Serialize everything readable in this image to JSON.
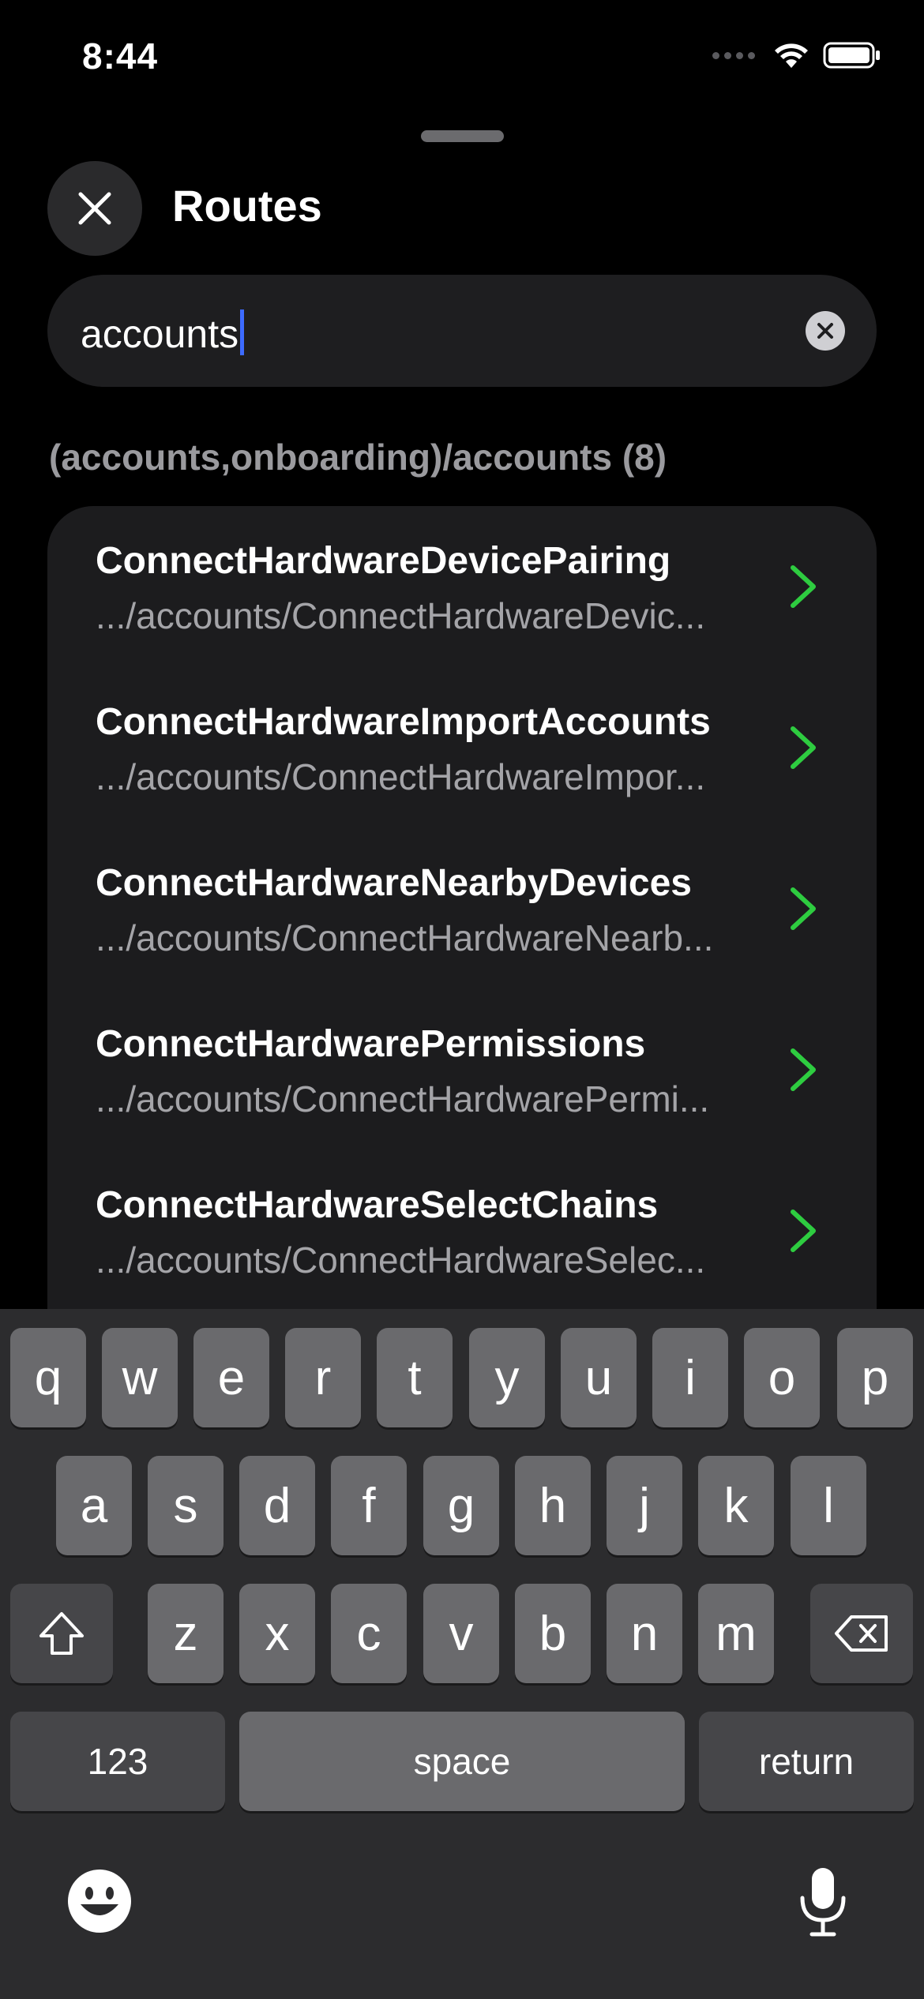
{
  "status_bar": {
    "time": "8:44"
  },
  "header": {
    "title": "Routes"
  },
  "search": {
    "value": "accounts"
  },
  "section": {
    "title": "(accounts,onboarding)/accounts (8)"
  },
  "routes": [
    {
      "name": "ConnectHardwareDevicePairing",
      "path": ".../accounts/ConnectHardwareDevic..."
    },
    {
      "name": "ConnectHardwareImportAccounts",
      "path": ".../accounts/ConnectHardwareImpor..."
    },
    {
      "name": "ConnectHardwareNearbyDevices",
      "path": ".../accounts/ConnectHardwareNearb..."
    },
    {
      "name": "ConnectHardwarePermissions",
      "path": ".../accounts/ConnectHardwarePermi..."
    },
    {
      "name": "ConnectHardwareSelectChains",
      "path": ".../accounts/ConnectHardwareSelec..."
    }
  ],
  "keyboard": {
    "row1": [
      "q",
      "w",
      "e",
      "r",
      "t",
      "y",
      "u",
      "i",
      "o",
      "p"
    ],
    "row2": [
      "a",
      "s",
      "d",
      "f",
      "g",
      "h",
      "j",
      "k",
      "l"
    ],
    "row3": [
      "z",
      "x",
      "c",
      "v",
      "b",
      "n",
      "m"
    ],
    "numbers_label": "123",
    "space_label": "space",
    "return_label": "return"
  },
  "colors": {
    "accent": "#3d6bff",
    "chevron": "#2ecc40",
    "card": "#1c1c1e",
    "key": "#6a6a6d"
  },
  "icons": [
    "close-icon",
    "clear-icon",
    "chevron-right-icon",
    "shift-icon",
    "backspace-icon",
    "emoji-icon",
    "microphone-icon",
    "wifi-icon",
    "battery-icon"
  ]
}
